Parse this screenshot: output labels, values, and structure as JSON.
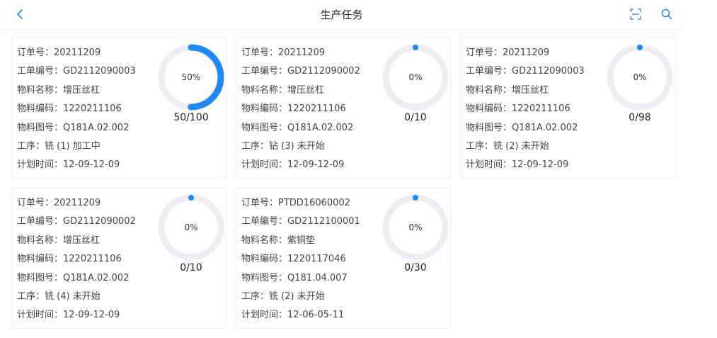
{
  "header": {
    "title": "生产任务"
  },
  "accent_color": "#1e88f5",
  "track_color": "#eceef3",
  "cards": [
    {
      "order_label": "订单号：",
      "order_no": "20211209",
      "wo_label": "工单编号：",
      "wo_no": "GD2112090003",
      "mat_name_label": "物料名称：",
      "mat_name": "增压丝杠",
      "mat_code_label": "物料编码：",
      "mat_code": "1220211106",
      "drawing_label": "物料图号：",
      "drawing": "Q181A.02.002",
      "process_label": "工序：",
      "process": "铣 (1) 加工中",
      "time_label": "计划时间：",
      "time": "12-09-12-09",
      "percent_text": "50%",
      "progress": 0.5,
      "ratio": "50/100"
    },
    {
      "order_label": "订单号：",
      "order_no": "20211209",
      "wo_label": "工单编号：",
      "wo_no": "GD2112090002",
      "mat_name_label": "物料名称：",
      "mat_name": "增压丝杠",
      "mat_code_label": "物料编码：",
      "mat_code": "1220211106",
      "drawing_label": "物料图号：",
      "drawing": "Q181A.02.002",
      "process_label": "工序：",
      "process": "钻 (3) 未开始",
      "time_label": "计划时间：",
      "time": "12-09-12-09",
      "percent_text": "0%",
      "progress": 0,
      "ratio": "0/10"
    },
    {
      "order_label": "订单号：",
      "order_no": "20211209",
      "wo_label": "工单编号：",
      "wo_no": "GD2112090003",
      "mat_name_label": "物料名称：",
      "mat_name": "增压丝杠",
      "mat_code_label": "物料编码：",
      "mat_code": "1220211106",
      "drawing_label": "物料图号：",
      "drawing": "Q181A.02.002",
      "process_label": "工序：",
      "process": "铣 (2) 未开始",
      "time_label": "计划时间：",
      "time": "12-09-12-09",
      "percent_text": "0%",
      "progress": 0,
      "ratio": "0/98"
    },
    {
      "order_label": "订单号：",
      "order_no": "20211209",
      "wo_label": "工单编号：",
      "wo_no": "GD2112090002",
      "mat_name_label": "物料名称：",
      "mat_name": "增压丝杠",
      "mat_code_label": "物料编码：",
      "mat_code": "1220211106",
      "drawing_label": "物料图号：",
      "drawing": "Q181A.02.002",
      "process_label": "工序：",
      "process": "铣 (4) 未开始",
      "time_label": "计划时间：",
      "time": "12-09-12-09",
      "percent_text": "0%",
      "progress": 0,
      "ratio": "0/10"
    },
    {
      "order_label": "订单号：",
      "order_no": "PTDD16060002",
      "wo_label": "工单编号：",
      "wo_no": "GD2112100001",
      "mat_name_label": "物料名称：",
      "mat_name": "紫铜垫",
      "mat_code_label": "物料编码：",
      "mat_code": "1220117046",
      "drawing_label": "物料图号：",
      "drawing": "Q181.04.007",
      "process_label": "工序：",
      "process": "铣 (2) 未开始",
      "time_label": "计划时间：",
      "time": "12-06-05-11",
      "percent_text": "0%",
      "progress": 0,
      "ratio": "0/30"
    }
  ]
}
